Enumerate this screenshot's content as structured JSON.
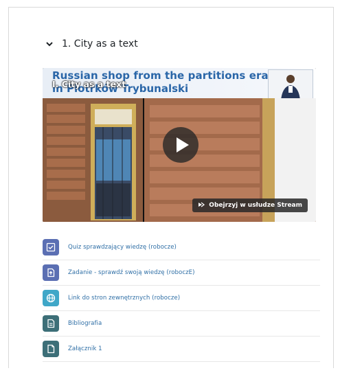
{
  "section": {
    "toggle_icon": "chevron-down-icon",
    "title": "1. City as a text"
  },
  "video": {
    "banner_title_line1": "Russian shop from the partitions era",
    "banner_title_line2": "in Piotrków Trybunalski",
    "overlay_title": "I. City as a text",
    "play_icon": "play-icon",
    "stream_button_label": "Obejrzyj w usłudze Stream"
  },
  "activities": [
    {
      "label": "Quiz sprawdzający wiedzę (robocze)",
      "icon": "quiz-check-icon",
      "color": "#5b6fb3"
    },
    {
      "label": "Zadanie - sprawdź swoją wiedzę (roboczE)",
      "icon": "assignment-upload-icon",
      "color": "#5b6fb3"
    },
    {
      "label": "Link do stron zewnętrznych (robocze)",
      "icon": "globe-icon",
      "color": "#3fa7c8"
    },
    {
      "label": "Bibliografia",
      "icon": "document-icon",
      "color": "#3d6f78"
    },
    {
      "label": "Załącznik 1",
      "icon": "file-icon",
      "color": "#3d6f78"
    }
  ]
}
